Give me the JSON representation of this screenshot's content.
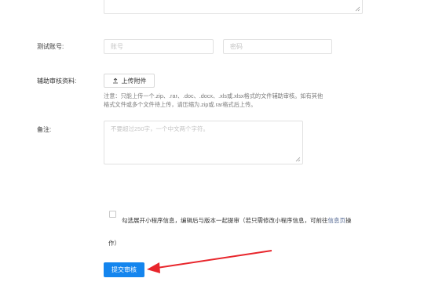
{
  "form": {
    "test_account_label": "测试账号:",
    "account_placeholder": "账号",
    "password_placeholder": "密码",
    "aux_material_label": "辅助审核资料:",
    "upload_button_label": "上传附件",
    "upload_note_line1": "注意：只能上传一个.zip、.rar、.doc、.docx、.xls或.xlsx格式的文件辅助审核。如有其他",
    "upload_note_line2": "格式文件或多个文件待上传，请压缩为.zip或.rar格式后上传。",
    "remark_label": "备注:",
    "remark_placeholder": "不要超过250字，一个中文两个字符。",
    "checkbox_text_before": "勾选展开小程序信息，编辑后与版本一起提审（若只需修改小程序信息，可前往",
    "checkbox_link": "信息页",
    "checkbox_text_after1": "操",
    "checkbox_text_after2": "作）",
    "submit_label": "提交审核"
  },
  "colors": {
    "accent": "#1485ee",
    "annotation_arrow": "#e8262c",
    "link": "#576b95"
  },
  "icons": {
    "upload": "upload-icon",
    "resize": "resize-grip-icon"
  }
}
